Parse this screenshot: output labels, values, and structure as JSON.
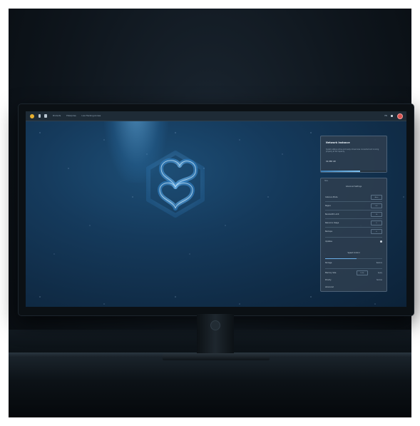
{
  "topbar": {
    "items": [
      "Products",
      "Enterprise",
      "Live Tracking Access"
    ],
    "right_label": "EN",
    "icons": [
      "logo-icon",
      "document-icon",
      "clipboard-icon",
      "bell-icon",
      "avatar"
    ]
  },
  "card_summary": {
    "title": "Network Instance",
    "text": "System status online and ready. All services connected and running properly at full capacity.",
    "value": "92,888 GB",
    "progress": 0.6
  },
  "settings_panel": {
    "header": "Tabs",
    "title": "Advanced Settings",
    "rows": [
      {
        "label": "Instance Mode",
        "control": "Auto"
      },
      {
        "label": "Region",
        "control": "EU"
      },
      {
        "label": "Bandwidth Limit",
        "control": "10"
      },
      {
        "label": "Resource Usage",
        "control": "5"
      },
      {
        "label": "Backups",
        "control": "6"
      },
      {
        "label": "Updates",
        "control": ""
      }
    ],
    "slider_label": "Speed Control",
    "slider_value": 0.55,
    "option_row": {
      "label": "Storage",
      "right": "Restore"
    },
    "field_row": {
      "label": "Memory Size",
      "value": "1024",
      "right": "Apply"
    },
    "last_row": {
      "label": "Priority",
      "right": "Normal"
    },
    "footer": "Advanced"
  },
  "colors": {
    "accent": "#3c7fb8",
    "logo": "#e8b030",
    "avatar": "#d9534f"
  }
}
